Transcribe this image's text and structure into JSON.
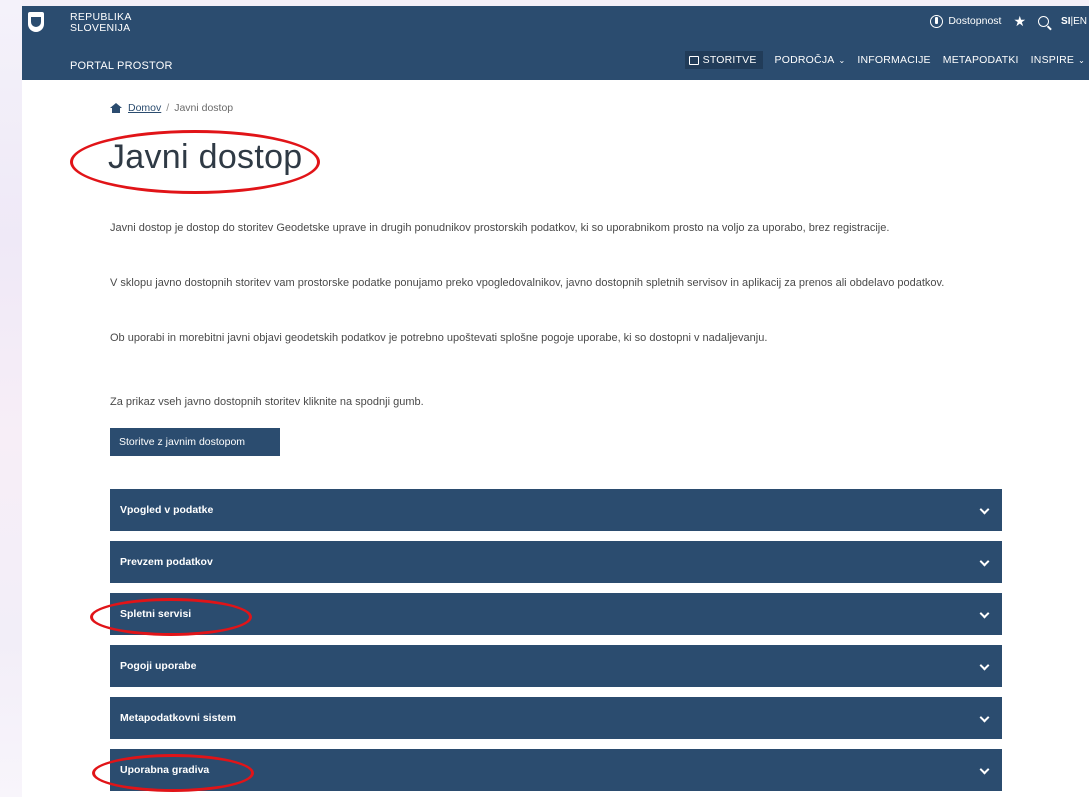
{
  "header": {
    "republic_line1": "REPUBLIKA",
    "republic_line2": "SLOVENIJA",
    "portal_name": "PORTAL PROSTOR",
    "topbar": {
      "accessibility": "Dostopnost",
      "lang_si": "SI",
      "lang_sep": "|",
      "lang_en": "EN"
    },
    "nav": [
      {
        "label": "STORITVE"
      },
      {
        "label": "PODROČJA"
      },
      {
        "label": "INFORMACIJE"
      },
      {
        "label": "METAPODATKI"
      },
      {
        "label": "INSPIRE"
      }
    ]
  },
  "breadcrumb": {
    "home": "Domov",
    "separator": "/",
    "current": "Javni dostop"
  },
  "page": {
    "title": "Javni dostop",
    "paragraphs": [
      "Javni dostop je dostop do storitev Geodetske uprave in drugih ponudnikov prostorskih podatkov, ki so uporabnikom prosto na voljo za uporabo, brez registracije.",
      "V sklopu javno dostopnih storitev vam prostorske podatke ponujamo preko vpogledovalnikov, javno dostopnih spletnih servisov in aplikacij za prenos ali obdelavo podatkov.",
      "Ob uporabi in morebitni javni objavi geodetskih podatkov je potrebno upoštevati splošne pogoje uporabe, ki so dostopni v nadaljevanju."
    ],
    "cta_text": "Za prikaz vseh javno dostopnih storitev kliknite na spodnji gumb.",
    "cta_button": "Storitve z javnim dostopom"
  },
  "accordion": [
    {
      "label": "Vpogled v podatke"
    },
    {
      "label": "Prevzem podatkov"
    },
    {
      "label": "Spletni servisi"
    },
    {
      "label": "Pogoji uporabe"
    },
    {
      "label": "Metapodatkovni sistem"
    },
    {
      "label": "Uporabna gradiva"
    }
  ],
  "colors": {
    "primary": "#2b4c6f",
    "annotation": "#e11418"
  }
}
